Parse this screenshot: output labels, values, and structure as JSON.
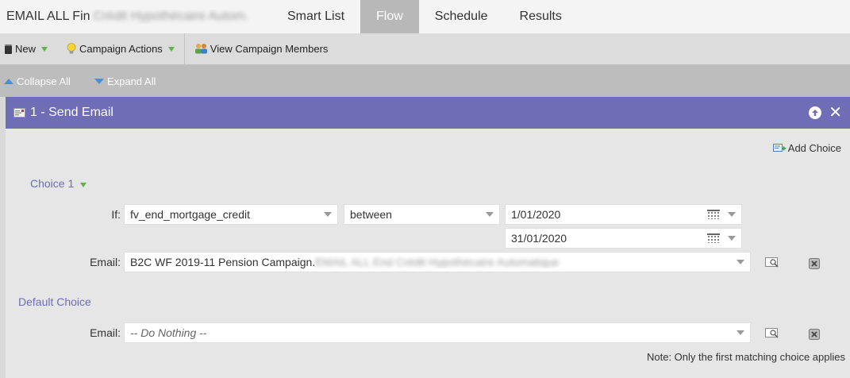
{
  "header": {
    "title_prefix": "EMAIL ALL Fin",
    "title_blurred": "Crédit Hypothécaire Autom.",
    "tabs": [
      {
        "label": "Smart List"
      },
      {
        "label": "Flow"
      },
      {
        "label": "Schedule"
      },
      {
        "label": "Results"
      }
    ],
    "active_tab": "Flow"
  },
  "toolbar": {
    "new_label": "New",
    "campaign_actions_label": "Campaign Actions",
    "view_members_label": "View Campaign Members"
  },
  "collapsebar": {
    "collapse_label": "Collapse All",
    "expand_label": "Expand All"
  },
  "step": {
    "title": "1 - Send Email",
    "add_choice_label": "Add Choice",
    "choice1": {
      "label": "Choice 1",
      "if_label": "If:",
      "attribute": "fv_end_mortgage_credit",
      "operator": "between",
      "date_from": "1/01/2020",
      "date_to": "31/01/2020",
      "email_label": "Email:",
      "email_value": "B2C WF 2019-11 Pension Campaign.",
      "email_value_blurred": "EMAIL ALL End Crédit Hypothécaire Automatique"
    },
    "default_choice": {
      "label": "Default Choice",
      "email_label": "Email:",
      "email_value": "-- Do Nothing --"
    },
    "note": "Note: Only the first matching choice applies"
  },
  "colors": {
    "accent": "#6e6db6",
    "active_tab": "#b8b8b8",
    "green": "#5db34a",
    "blue": "#4a90d9"
  }
}
